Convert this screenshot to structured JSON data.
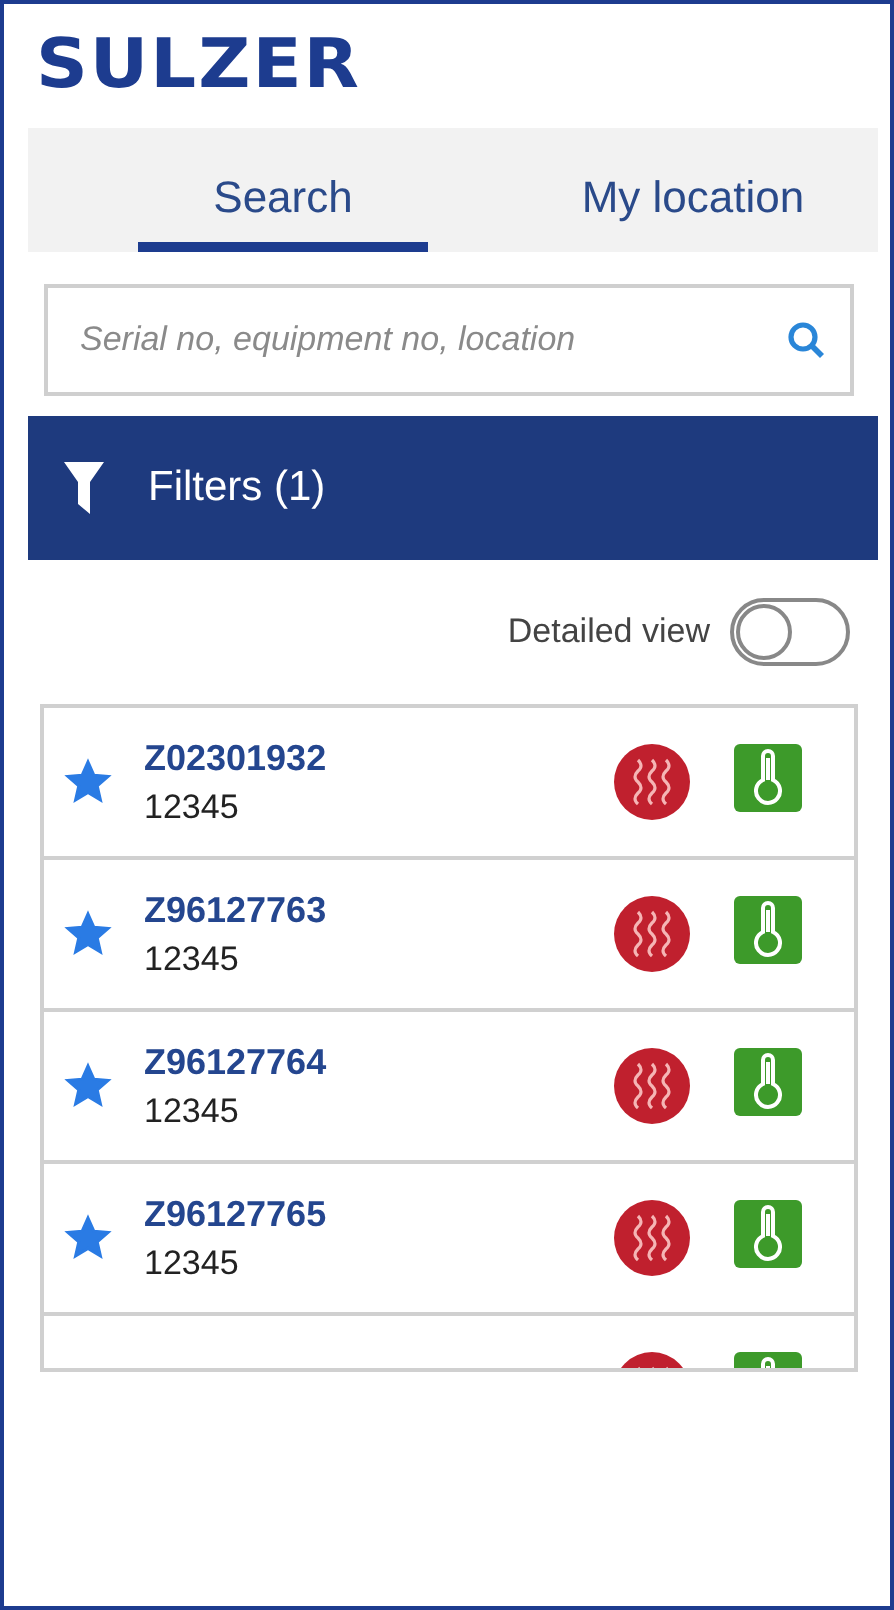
{
  "logo": "SULZER",
  "tabs": [
    {
      "label": "Search",
      "selected": true
    },
    {
      "label": "My location",
      "selected": false
    }
  ],
  "search": {
    "placeholder": "Serial no, equipment no, location"
  },
  "filters": {
    "label": "Filters (1)"
  },
  "detailed_view": {
    "label": "Detailed view",
    "on": false
  },
  "rows": [
    {
      "serial": "Z02301932",
      "number": "12345",
      "favorite": true
    },
    {
      "serial": "Z96127763",
      "number": "12345",
      "favorite": true
    },
    {
      "serial": "Z96127764",
      "number": "12345",
      "favorite": true
    },
    {
      "serial": "Z96127765",
      "number": "12345",
      "favorite": true
    }
  ],
  "more_rows_below": true
}
